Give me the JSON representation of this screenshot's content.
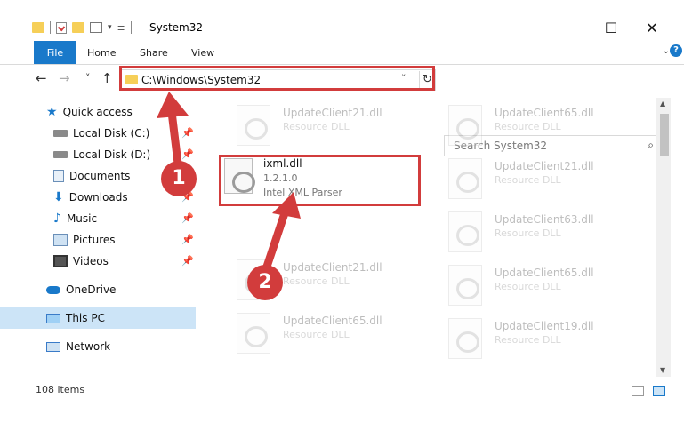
{
  "window": {
    "title": "System32",
    "minimize_glyph": "—",
    "maximize_glyph": "☐",
    "close_glyph": "✕"
  },
  "ribbon": {
    "tabs": [
      {
        "label": "File"
      },
      {
        "label": "Home"
      },
      {
        "label": "Share"
      },
      {
        "label": "View"
      }
    ],
    "expand_glyph": "⌄",
    "help_glyph": "?"
  },
  "nav": {
    "back_glyph": "←",
    "forward_glyph": "→",
    "recent_glyph": "˅",
    "up_glyph": "↑",
    "address": "C:\\Windows\\System32",
    "refresh_glyph": "↻",
    "dropdown_glyph": "˅",
    "search_placeholder": "Search System32",
    "search_glyph": "⌕"
  },
  "sidebar": {
    "items": [
      {
        "label": "Quick access",
        "pinned": false
      },
      {
        "label": "Local Disk (C:)",
        "pinned": true
      },
      {
        "label": "Local Disk (D:)",
        "pinned": true
      },
      {
        "label": "Documents",
        "pinned": true
      },
      {
        "label": "Downloads",
        "pinned": true
      },
      {
        "label": "Music",
        "pinned": true
      },
      {
        "label": "Pictures",
        "pinned": true
      },
      {
        "label": "Videos",
        "pinned": true
      },
      {
        "label": "OneDrive",
        "pinned": false
      },
      {
        "label": "This PC",
        "pinned": false
      },
      {
        "label": "Network",
        "pinned": false
      }
    ],
    "pin_glyph": "📌"
  },
  "files": {
    "left_column": [
      {
        "name": "UpdateClient21.dll",
        "desc": "Resource DLL"
      },
      {
        "name": "ixml.dll",
        "desc": "1.2.1.0",
        "desc2": "Intel XML Parser"
      },
      {
        "name": "UpdateClient21.dll",
        "desc": "Resource DLL"
      },
      {
        "name": "UpdateClient65.dll",
        "desc": "Resource DLL"
      }
    ],
    "right_column": [
      {
        "name": "UpdateClient65.dll",
        "desc": "Resource DLL"
      },
      {
        "name": "UpdateClient21.dll",
        "desc": "Resource DLL"
      },
      {
        "name": "UpdateClient63.dll",
        "desc": "Resource DLL"
      },
      {
        "name": "UpdateClient65.dll",
        "desc": "Resource DLL"
      },
      {
        "name": "UpdateClient19.dll",
        "desc": "Resource DLL"
      }
    ]
  },
  "status": {
    "item_count": "108 items"
  },
  "annotations": {
    "step1": "1",
    "step2": "2"
  },
  "colors": {
    "accent": "#1979ca",
    "highlight": "#d23c3c",
    "selected_nav": "#cce4f7"
  }
}
